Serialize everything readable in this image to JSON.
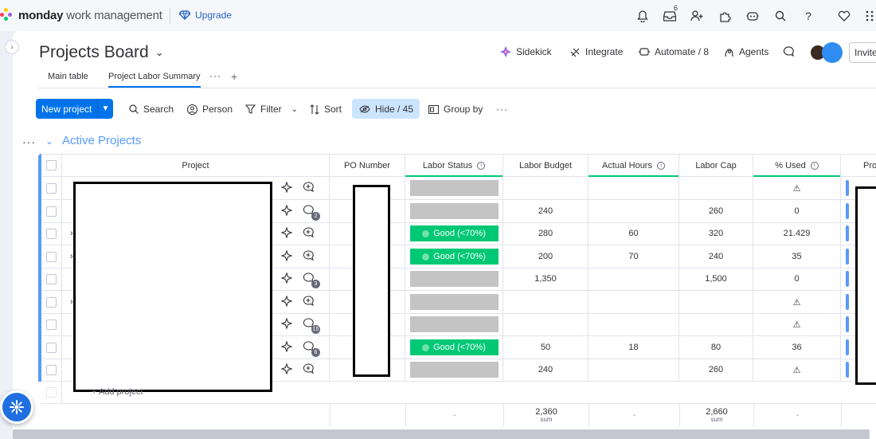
{
  "app": {
    "brand_bold": "monday",
    "brand_light": "work management",
    "upgrade_label": "Upgrade",
    "notification_count": "6"
  },
  "board": {
    "title": "Projects Board",
    "actions": {
      "sidekick": "Sidekick",
      "integrate": "Integrate",
      "automate": "Automate / 8",
      "agents": "Agents",
      "invite": "Invite"
    },
    "tabs": [
      {
        "label": "Main table",
        "active": false
      },
      {
        "label": "Project Labor Summary",
        "active": true
      }
    ]
  },
  "toolbar": {
    "new_project": "New project",
    "search": "Search",
    "person": "Person",
    "filter": "Filter",
    "sort": "Sort",
    "hide": "Hide / 45",
    "group_by": "Group by"
  },
  "group": {
    "title": "Active Projects",
    "color": "#579bfc",
    "add_item": "+ Add project"
  },
  "columns": {
    "project": "Project",
    "po_number": "PO Number",
    "labor_status": "Labor Status",
    "labor_budget": "Labor Budget",
    "actual_hours": "Actual Hours",
    "labor_cap": "Labor Cap",
    "pct_used": "% Used",
    "next": "Pro"
  },
  "rows": [
    {
      "status": "",
      "budget": "",
      "hours": "",
      "cap": "",
      "used": "⚠",
      "updates": ""
    },
    {
      "status": "",
      "budget": "240",
      "hours": "",
      "cap": "260",
      "used": "0",
      "updates": "2"
    },
    {
      "status": "Good (<70%)",
      "budget": "280",
      "hours": "60",
      "cap": "320",
      "used": "21.429",
      "updates": ""
    },
    {
      "status": "Good (<70%)",
      "budget": "200",
      "hours": "70",
      "cap": "240",
      "used": "35",
      "updates": ""
    },
    {
      "status": "",
      "budget": "1,350",
      "hours": "",
      "cap": "1,500",
      "used": "0",
      "updates": "3"
    },
    {
      "status": "",
      "budget": "",
      "hours": "",
      "cap": "",
      "used": "⚠",
      "updates": ""
    },
    {
      "status": "",
      "budget": "",
      "hours": "",
      "cap": "",
      "used": "⚠",
      "updates": "15"
    },
    {
      "status": "Good (<70%)",
      "budget": "50",
      "hours": "18",
      "cap": "80",
      "used": "36",
      "updates": "6"
    },
    {
      "status": "",
      "budget": "240",
      "hours": "",
      "cap": "260",
      "used": "⚠",
      "updates": ""
    }
  ],
  "summary": {
    "status": "-",
    "budget": "2,360",
    "budget_sub": "sum",
    "hours": "-",
    "cap": "2,660",
    "cap_sub": "sum",
    "used": "-"
  },
  "colors": {
    "primary": "#0073ea",
    "good": "#00c875",
    "empty_status": "#c4c4c4"
  }
}
